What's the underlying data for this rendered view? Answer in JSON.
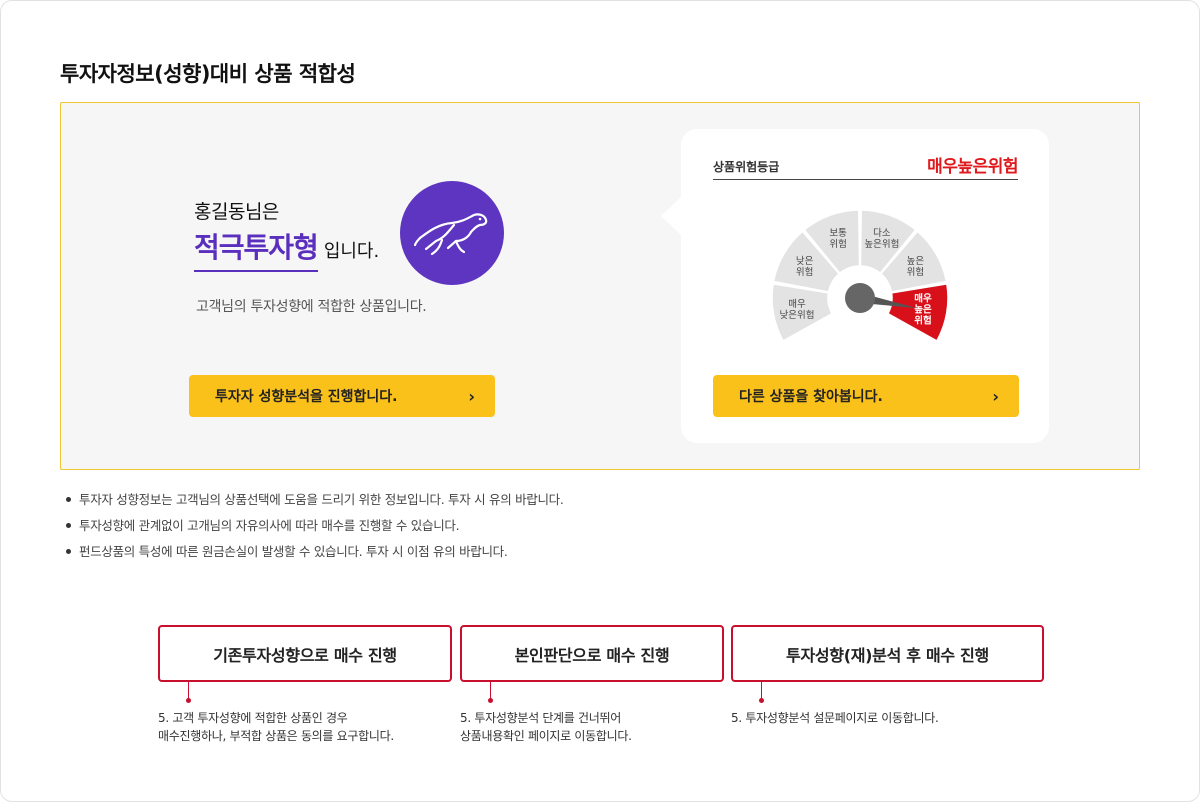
{
  "page_title": "투자자정보(성향)대비 상품 적합성",
  "profile": {
    "user_line": "홍길동님은",
    "type_name": "적극투자형",
    "type_suffix": "입니다.",
    "description": "고객님의 투자성향에 적합한 상품입니다.",
    "icon": "cheetah-icon",
    "accent_color": "#5b2fbe"
  },
  "buttons": {
    "analyze": "투자자 성향분석을 진행합니다.",
    "find_other": "다른 상품을 찾아봅니다.",
    "chevron": "›"
  },
  "risk": {
    "label": "상품위험등급",
    "value": "매우높은위험",
    "value_color": "#e0191e",
    "selected_index": 5,
    "levels": [
      [
        "매우",
        "낮은위험"
      ],
      [
        "낮은",
        "위험"
      ],
      [
        "보통",
        "위험"
      ],
      [
        "다소",
        "높은위험"
      ],
      [
        "높은",
        "위험"
      ],
      [
        "매우",
        "높은",
        "위험"
      ]
    ]
  },
  "notes": [
    "투자자 성향정보는 고객님의 상품선택에 도움을 드리기 위한 정보입니다. 투자 시 유의 바랍니다.",
    "투자성향에 관계없이 고개님의 자유의사에 따라 매수를 진행할 수 있습니다.",
    "펀드상품의 특성에 따른 원금손실이 발생할 수 있습니다. 투자 시 이점 유의 바랍니다."
  ],
  "actions": [
    {
      "label": "기존투자성향으로 매수 진행",
      "desc_line1": "5. 고객 투자성향에 적합한 상품인 경우",
      "desc_line2": "매수진행하나, 부적합 상품은 동의를 요구합니다."
    },
    {
      "label": "본인판단으로 매수 진행",
      "desc_line1": "5. 투자성향분석 단계를 건너뛰어",
      "desc_line2": "상품내용확인 페이지로 이동합니다."
    },
    {
      "label": "투자성향(재)분석 후 매수 진행",
      "desc_line1": "5. 투자성향분석 설문페이지로 이동합니다.",
      "desc_line2": ""
    }
  ]
}
